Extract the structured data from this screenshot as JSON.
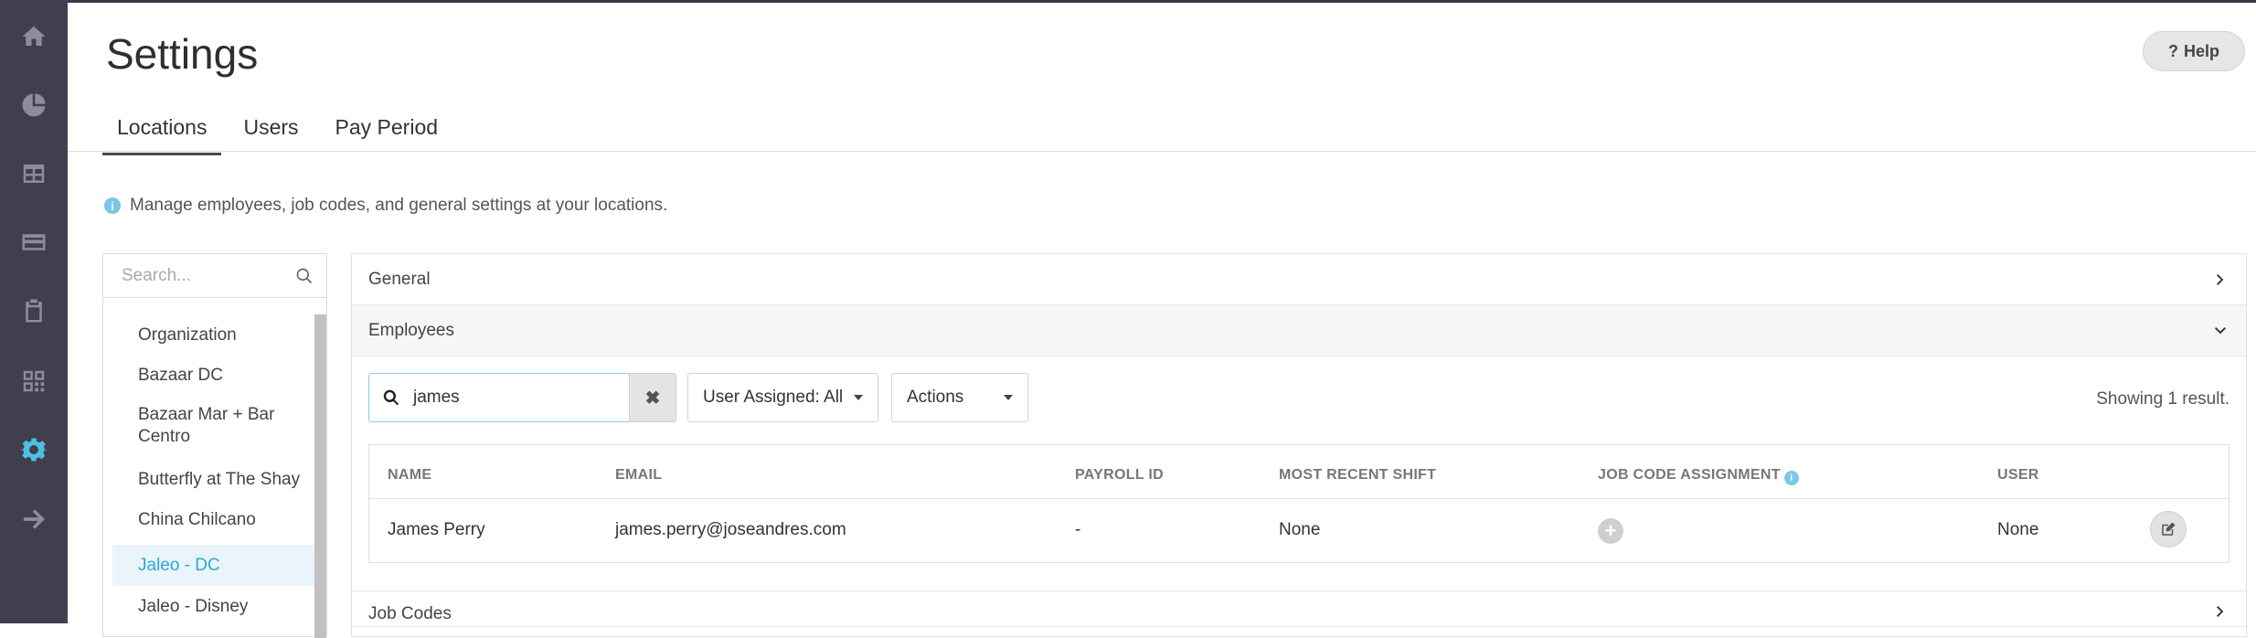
{
  "rail": {
    "items": [
      "home-icon",
      "pie-chart-icon",
      "table-icon",
      "credit-card-icon",
      "clipboard-icon",
      "qr-code-icon",
      "gear-icon",
      "arrow-right-icon"
    ],
    "active": "gear-icon"
  },
  "header": {
    "title": "Settings",
    "help_label": "Help",
    "help_glyph": "?"
  },
  "tabs": [
    {
      "label": "Locations"
    },
    {
      "label": "Users"
    },
    {
      "label": "Pay Period"
    }
  ],
  "info": {
    "text": "Manage employees, job codes, and general settings at your locations.",
    "glyph": "i"
  },
  "locations": {
    "search_placeholder": "Search...",
    "items": [
      {
        "label": "Organization"
      },
      {
        "label": "Bazaar DC"
      },
      {
        "label": "Bazaar Mar + Bar Centro"
      },
      {
        "label": "Butterfly at The Shay"
      },
      {
        "label": "China Chilcano"
      },
      {
        "label": "Jaleo - DC"
      },
      {
        "label": "Jaleo - Disney"
      }
    ],
    "selected": "Jaleo - DC"
  },
  "sections": {
    "general": "General",
    "employees": "Employees",
    "job_codes": "Job Codes"
  },
  "employees": {
    "search_value": "james",
    "clear_glyph": "✖",
    "user_assigned_label": "User Assigned: All",
    "actions_label": "Actions",
    "result_text": "Showing 1 result.",
    "columns": {
      "name": "NAME",
      "email": "EMAIL",
      "payroll_id": "PAYROLL ID",
      "most_recent_shift": "MOST RECENT SHIFT",
      "job_code_assignment": "JOB CODE ASSIGNMENT",
      "user": "USER"
    },
    "rows": [
      {
        "name": "James Perry",
        "email": "james.perry@joseandres.com",
        "payroll_id": "-",
        "most_recent_shift": "None",
        "job_code_glyph": "+",
        "user": "None"
      }
    ]
  },
  "colors": {
    "accent": "#2ba9d6",
    "rail_bg": "#3f3f4e",
    "active_icon": "#4ec0e6"
  }
}
